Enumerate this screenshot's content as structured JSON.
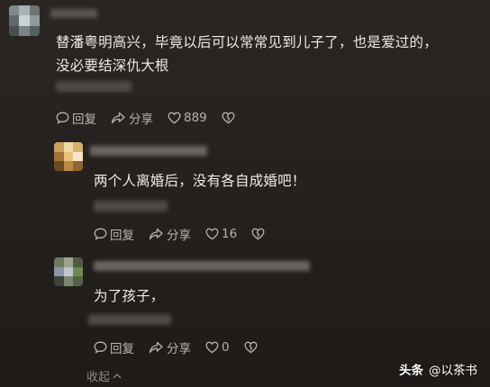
{
  "comments": [
    {
      "text_lines": [
        "替潘粤明高兴，毕竟以后可以常常见到儿子了，也是爱过的，",
        "没必要结深仇大根"
      ],
      "actions": {
        "reply": "回复",
        "share": "分享",
        "likes": "889"
      }
    },
    {
      "text_lines": [
        "两个人离婚后，没有各自成婚吧！"
      ],
      "actions": {
        "reply": "回复",
        "share": "分享",
        "likes": "16"
      }
    },
    {
      "text_lines": [
        "为了孩子，"
      ],
      "actions": {
        "reply": "回复",
        "share": "分享",
        "likes": "0"
      }
    }
  ],
  "collapse_label": "收起",
  "watermark": {
    "platform": "头条",
    "account": "@以茶书"
  },
  "icons": [
    "chat-bubble-icon",
    "share-arrow-icon",
    "heart-icon",
    "broken-heart-icon",
    "chevron-up-icon"
  ]
}
